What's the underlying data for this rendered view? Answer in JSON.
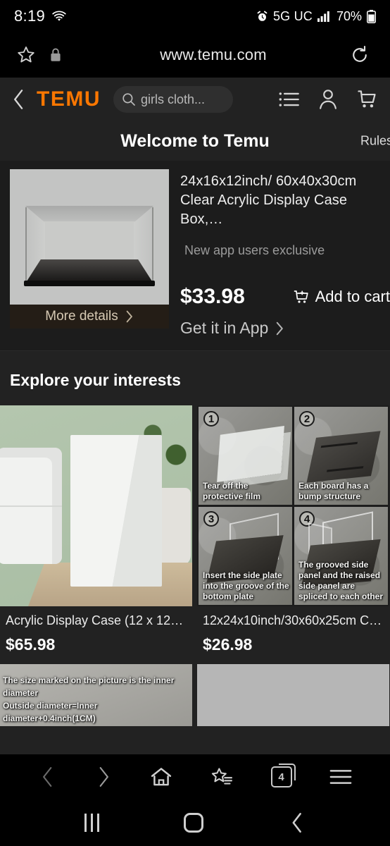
{
  "status_bar": {
    "time": "8:19",
    "wifi_icon": "wifi-icon",
    "alarm_icon": "alarm-icon",
    "network": "5G UC",
    "signal_icon": "signal-bars-icon",
    "battery": "70%",
    "battery_icon": "battery-icon"
  },
  "url_bar": {
    "bookmark_icon": "star-icon",
    "lock_icon": "lock-icon",
    "url": "www.temu.com",
    "reload_icon": "reload-icon"
  },
  "site_header": {
    "back_icon": "chevron-left-icon",
    "logo": "TEMU",
    "search_icon": "search-icon",
    "search_value": "girls cloth...",
    "search_placeholder": "Search",
    "categories_icon": "list-icon",
    "account_icon": "person-icon",
    "cart_icon": "cart-icon"
  },
  "welcome": {
    "title": "Welcome to Temu",
    "rules_label": "Rules"
  },
  "promo": {
    "image_alt": "clear-acrylic-display-case",
    "more_details_label": "More details",
    "more_details_chevron": "chevron-right-icon",
    "title": "24x16x12inch/ 60x40x30cm Clear Acrylic Display Case Box,…",
    "subtitle": "New app users exclusive",
    "price": "$33.98",
    "add_to_cart_icon": "cart-plus-icon",
    "add_to_cart_label": "Add to cart",
    "get_in_app_label": "Get it in App",
    "get_in_app_chevron": "chevron-right-icon"
  },
  "explore": {
    "heading": "Explore your interests",
    "items": [
      {
        "image_alt": "white-acrylic-display-case-on-table",
        "title": "Acrylic Display Case (12 x 12 x…",
        "price": "$65.98"
      },
      {
        "image_alt": "assembly-instructions-four-steps",
        "title": "12x24x10inch/30x60x25cm Cl…",
        "price": "$26.98",
        "steps": [
          {
            "number": "1",
            "caption": "Tear off the protective film"
          },
          {
            "number": "2",
            "caption": "Each board has a bump structure"
          },
          {
            "number": "3",
            "caption": "Insert the side plate into the groove of the bottom plate"
          },
          {
            "number": "4",
            "caption": "The grooved side panel and the raised side panel are spliced to each other"
          }
        ]
      }
    ],
    "partial_row": [
      {
        "image_alt": "size-chart-image",
        "caption_line1": "The size marked on the picture is the inner diameter",
        "caption_line2": "Outside diameter=Inner diameter+0.4inch(1CM)"
      },
      {
        "image_alt": "plain-gray-product-image"
      }
    ]
  },
  "browser_toolbar": {
    "back_icon": "chevron-left-icon",
    "forward_icon": "chevron-right-icon",
    "home_icon": "home-icon",
    "bookmarks_icon": "bookmarks-star-icon",
    "tabs_icon": "tabs-icon",
    "tab_count": "4",
    "menu_icon": "hamburger-menu-icon"
  },
  "android_nav": {
    "recents_icon": "recents-icon",
    "home_icon": "home-circle-icon",
    "back_icon": "back-chevron-icon"
  },
  "colors": {
    "brand_orange": "#fb7701",
    "page_bg": "#222222",
    "promo_bg": "#1c1c1c",
    "more_details_bg": "#241d16",
    "more_details_text": "#d6c9b3"
  }
}
